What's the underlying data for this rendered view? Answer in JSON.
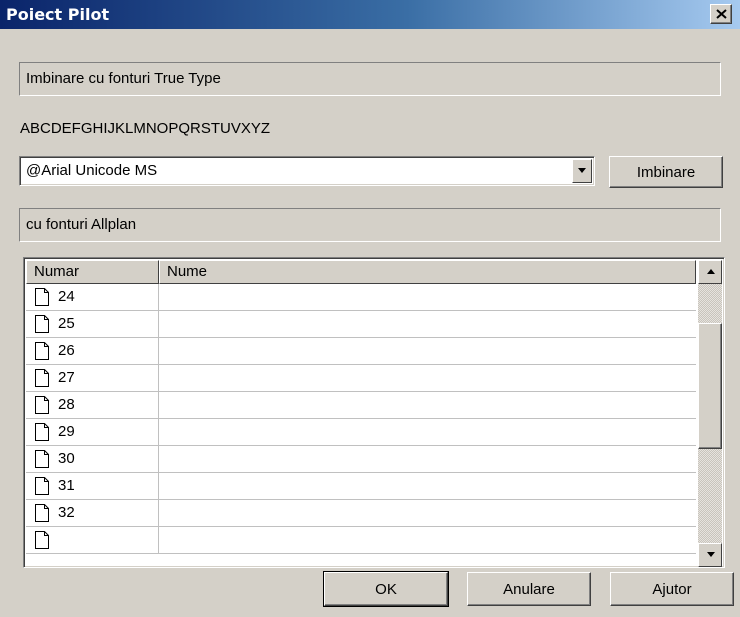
{
  "window": {
    "title": "Poiect Pilot",
    "close_label": "×"
  },
  "truetype_group_label": "Imbinare cu fonturi True Type",
  "alphabet_sample": "ABCDEFGHIJKLMNOPQRSTUVXYZ",
  "font_combo": {
    "value": "@Arial Unicode MS"
  },
  "merge_button_label": "Imbinare",
  "allplan_group_label": "cu fonturi Allplan",
  "list": {
    "columns": [
      "Numar",
      "Nume"
    ],
    "rows": [
      {
        "num": "24",
        "name": ""
      },
      {
        "num": "25",
        "name": ""
      },
      {
        "num": "26",
        "name": ""
      },
      {
        "num": "27",
        "name": ""
      },
      {
        "num": "28",
        "name": ""
      },
      {
        "num": "29",
        "name": ""
      },
      {
        "num": "30",
        "name": ""
      },
      {
        "num": "31",
        "name": ""
      },
      {
        "num": "32",
        "name": ""
      },
      {
        "num": "",
        "name": ""
      }
    ]
  },
  "buttons": {
    "ok": "OK",
    "cancel": "Anulare",
    "help": "Ajutor"
  },
  "colors": {
    "titlebar_start": "#0a246a",
    "titlebar_end": "#a6caf0",
    "face": "#d4d0c8"
  }
}
